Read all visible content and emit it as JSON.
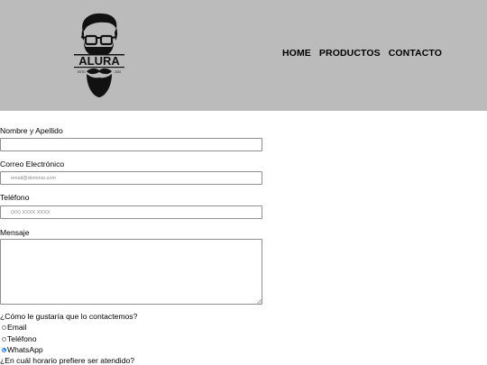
{
  "header": {
    "logo": {
      "brand": "ALURA",
      "est": "ESTD",
      "year": "2020"
    },
    "nav": [
      {
        "label": "HOME"
      },
      {
        "label": "PRODUCTOS"
      },
      {
        "label": "CONTACTO"
      }
    ]
  },
  "form": {
    "name": {
      "label": "Nombre y Apellido",
      "value": "",
      "placeholder": ""
    },
    "email": {
      "label": "Correo Electrónico",
      "value": "",
      "placeholder": "email@dominio.com"
    },
    "phone": {
      "label": "Teléfono",
      "value": "",
      "placeholder": "(XX) XXXX XXXX"
    },
    "message": {
      "label": "Mensaje",
      "value": ""
    },
    "contact_question": "¿Cómo le gustaría que lo contactemos?",
    "contact_options": [
      {
        "label": "Email",
        "checked": false
      },
      {
        "label": "Teléfono",
        "checked": false
      },
      {
        "label": "WhatsApp",
        "checked": true
      }
    ],
    "schedule_question": "¿En cuál horario prefiere ser atendido?"
  }
}
